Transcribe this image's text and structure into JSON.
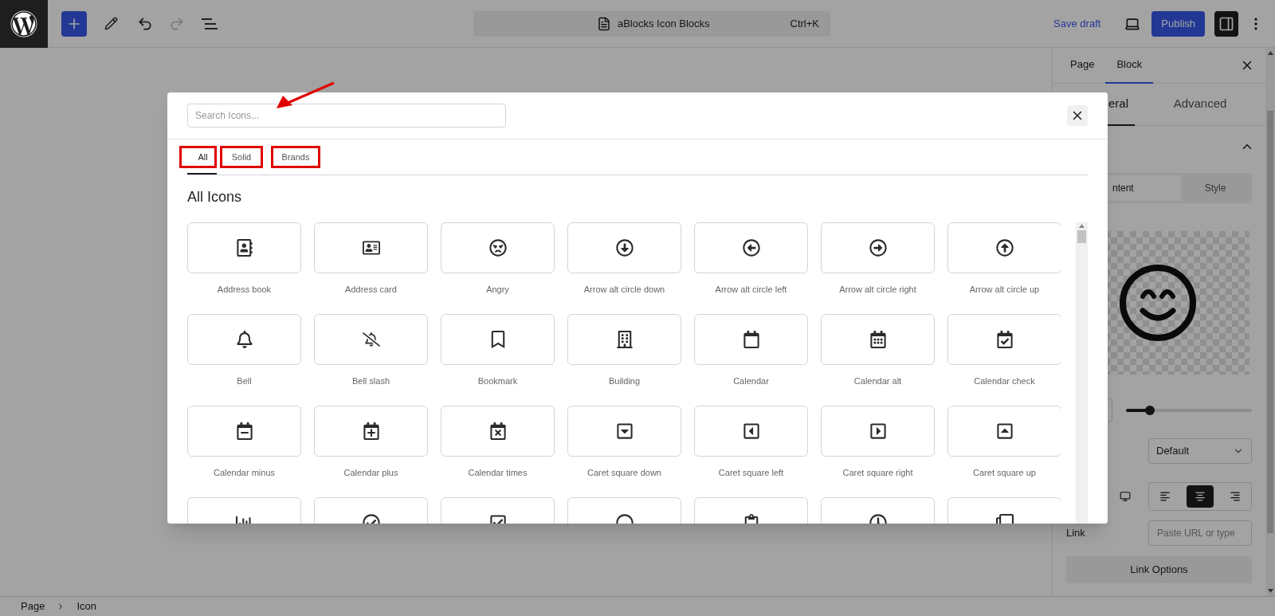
{
  "topbar": {
    "document_title": "aBlocks Icon Blocks",
    "shortcut": "Ctrl+K",
    "save_draft": "Save draft",
    "publish": "Publish",
    "redo_disabled": true,
    "settings_panel_open": true
  },
  "modal": {
    "search_placeholder": "Search Icons...",
    "tabs": [
      {
        "label": "All",
        "selected": true,
        "highlighted": true
      },
      {
        "label": "Solid",
        "selected": false,
        "highlighted": true
      },
      {
        "label": "Brands",
        "selected": false,
        "highlighted": true
      }
    ],
    "annotation_arrow": true,
    "heading": "All Icons",
    "icons": [
      {
        "label": "Address book"
      },
      {
        "label": "Address card"
      },
      {
        "label": "Angry"
      },
      {
        "label": "Arrow alt circle down"
      },
      {
        "label": "Arrow alt circle left"
      },
      {
        "label": "Arrow alt circle right"
      },
      {
        "label": "Arrow alt circle up"
      },
      {
        "label": "Bell"
      },
      {
        "label": "Bell slash"
      },
      {
        "label": "Bookmark"
      },
      {
        "label": "Building"
      },
      {
        "label": "Calendar"
      },
      {
        "label": "Calendar alt"
      },
      {
        "label": "Calendar check"
      },
      {
        "label": "Calendar minus"
      },
      {
        "label": "Calendar plus"
      },
      {
        "label": "Calendar times"
      },
      {
        "label": "Caret square down"
      },
      {
        "label": "Caret square left"
      },
      {
        "label": "Caret square right"
      },
      {
        "label": "Caret square up"
      }
    ]
  },
  "sidebar": {
    "tabs": [
      {
        "label": "Page",
        "selected": false
      },
      {
        "label": "Block",
        "selected": true
      }
    ],
    "subtabs": [
      {
        "label": "eral",
        "selected": true
      },
      {
        "label": "Advanced",
        "selected": false
      }
    ],
    "mode_tabs": [
      {
        "label": "ntent",
        "selected": true
      },
      {
        "label": "Style",
        "selected": false
      }
    ],
    "size_slider": {
      "level": 0.19
    },
    "select_value": "Default",
    "alignments": [
      {
        "selected": false
      },
      {
        "selected": true
      },
      {
        "selected": false
      }
    ],
    "link_label": "Link",
    "link_placeholder": "Paste URL or type",
    "link_options": "Link Options"
  },
  "breadcrumb": [
    "Page",
    "Icon"
  ]
}
